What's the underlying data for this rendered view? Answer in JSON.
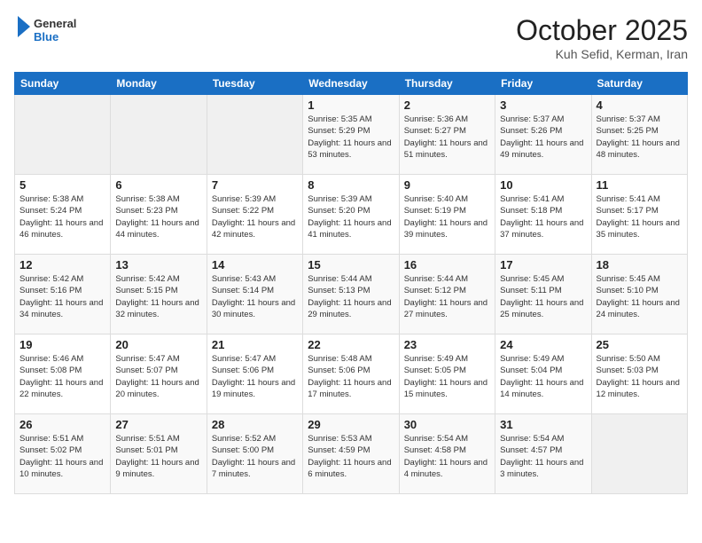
{
  "header": {
    "logo_general": "General",
    "logo_blue": "Blue",
    "month": "October 2025",
    "location": "Kuh Sefid, Kerman, Iran"
  },
  "weekdays": [
    "Sunday",
    "Monday",
    "Tuesday",
    "Wednesday",
    "Thursday",
    "Friday",
    "Saturday"
  ],
  "weeks": [
    [
      {
        "day": "",
        "info": ""
      },
      {
        "day": "",
        "info": ""
      },
      {
        "day": "",
        "info": ""
      },
      {
        "day": "1",
        "info": "Sunrise: 5:35 AM\nSunset: 5:29 PM\nDaylight: 11 hours and 53 minutes."
      },
      {
        "day": "2",
        "info": "Sunrise: 5:36 AM\nSunset: 5:27 PM\nDaylight: 11 hours and 51 minutes."
      },
      {
        "day": "3",
        "info": "Sunrise: 5:37 AM\nSunset: 5:26 PM\nDaylight: 11 hours and 49 minutes."
      },
      {
        "day": "4",
        "info": "Sunrise: 5:37 AM\nSunset: 5:25 PM\nDaylight: 11 hours and 48 minutes."
      }
    ],
    [
      {
        "day": "5",
        "info": "Sunrise: 5:38 AM\nSunset: 5:24 PM\nDaylight: 11 hours and 46 minutes."
      },
      {
        "day": "6",
        "info": "Sunrise: 5:38 AM\nSunset: 5:23 PM\nDaylight: 11 hours and 44 minutes."
      },
      {
        "day": "7",
        "info": "Sunrise: 5:39 AM\nSunset: 5:22 PM\nDaylight: 11 hours and 42 minutes."
      },
      {
        "day": "8",
        "info": "Sunrise: 5:39 AM\nSunset: 5:20 PM\nDaylight: 11 hours and 41 minutes."
      },
      {
        "day": "9",
        "info": "Sunrise: 5:40 AM\nSunset: 5:19 PM\nDaylight: 11 hours and 39 minutes."
      },
      {
        "day": "10",
        "info": "Sunrise: 5:41 AM\nSunset: 5:18 PM\nDaylight: 11 hours and 37 minutes."
      },
      {
        "day": "11",
        "info": "Sunrise: 5:41 AM\nSunset: 5:17 PM\nDaylight: 11 hours and 35 minutes."
      }
    ],
    [
      {
        "day": "12",
        "info": "Sunrise: 5:42 AM\nSunset: 5:16 PM\nDaylight: 11 hours and 34 minutes."
      },
      {
        "day": "13",
        "info": "Sunrise: 5:42 AM\nSunset: 5:15 PM\nDaylight: 11 hours and 32 minutes."
      },
      {
        "day": "14",
        "info": "Sunrise: 5:43 AM\nSunset: 5:14 PM\nDaylight: 11 hours and 30 minutes."
      },
      {
        "day": "15",
        "info": "Sunrise: 5:44 AM\nSunset: 5:13 PM\nDaylight: 11 hours and 29 minutes."
      },
      {
        "day": "16",
        "info": "Sunrise: 5:44 AM\nSunset: 5:12 PM\nDaylight: 11 hours and 27 minutes."
      },
      {
        "day": "17",
        "info": "Sunrise: 5:45 AM\nSunset: 5:11 PM\nDaylight: 11 hours and 25 minutes."
      },
      {
        "day": "18",
        "info": "Sunrise: 5:45 AM\nSunset: 5:10 PM\nDaylight: 11 hours and 24 minutes."
      }
    ],
    [
      {
        "day": "19",
        "info": "Sunrise: 5:46 AM\nSunset: 5:08 PM\nDaylight: 11 hours and 22 minutes."
      },
      {
        "day": "20",
        "info": "Sunrise: 5:47 AM\nSunset: 5:07 PM\nDaylight: 11 hours and 20 minutes."
      },
      {
        "day": "21",
        "info": "Sunrise: 5:47 AM\nSunset: 5:06 PM\nDaylight: 11 hours and 19 minutes."
      },
      {
        "day": "22",
        "info": "Sunrise: 5:48 AM\nSunset: 5:06 PM\nDaylight: 11 hours and 17 minutes."
      },
      {
        "day": "23",
        "info": "Sunrise: 5:49 AM\nSunset: 5:05 PM\nDaylight: 11 hours and 15 minutes."
      },
      {
        "day": "24",
        "info": "Sunrise: 5:49 AM\nSunset: 5:04 PM\nDaylight: 11 hours and 14 minutes."
      },
      {
        "day": "25",
        "info": "Sunrise: 5:50 AM\nSunset: 5:03 PM\nDaylight: 11 hours and 12 minutes."
      }
    ],
    [
      {
        "day": "26",
        "info": "Sunrise: 5:51 AM\nSunset: 5:02 PM\nDaylight: 11 hours and 10 minutes."
      },
      {
        "day": "27",
        "info": "Sunrise: 5:51 AM\nSunset: 5:01 PM\nDaylight: 11 hours and 9 minutes."
      },
      {
        "day": "28",
        "info": "Sunrise: 5:52 AM\nSunset: 5:00 PM\nDaylight: 11 hours and 7 minutes."
      },
      {
        "day": "29",
        "info": "Sunrise: 5:53 AM\nSunset: 4:59 PM\nDaylight: 11 hours and 6 minutes."
      },
      {
        "day": "30",
        "info": "Sunrise: 5:54 AM\nSunset: 4:58 PM\nDaylight: 11 hours and 4 minutes."
      },
      {
        "day": "31",
        "info": "Sunrise: 5:54 AM\nSunset: 4:57 PM\nDaylight: 11 hours and 3 minutes."
      },
      {
        "day": "",
        "info": ""
      }
    ]
  ]
}
